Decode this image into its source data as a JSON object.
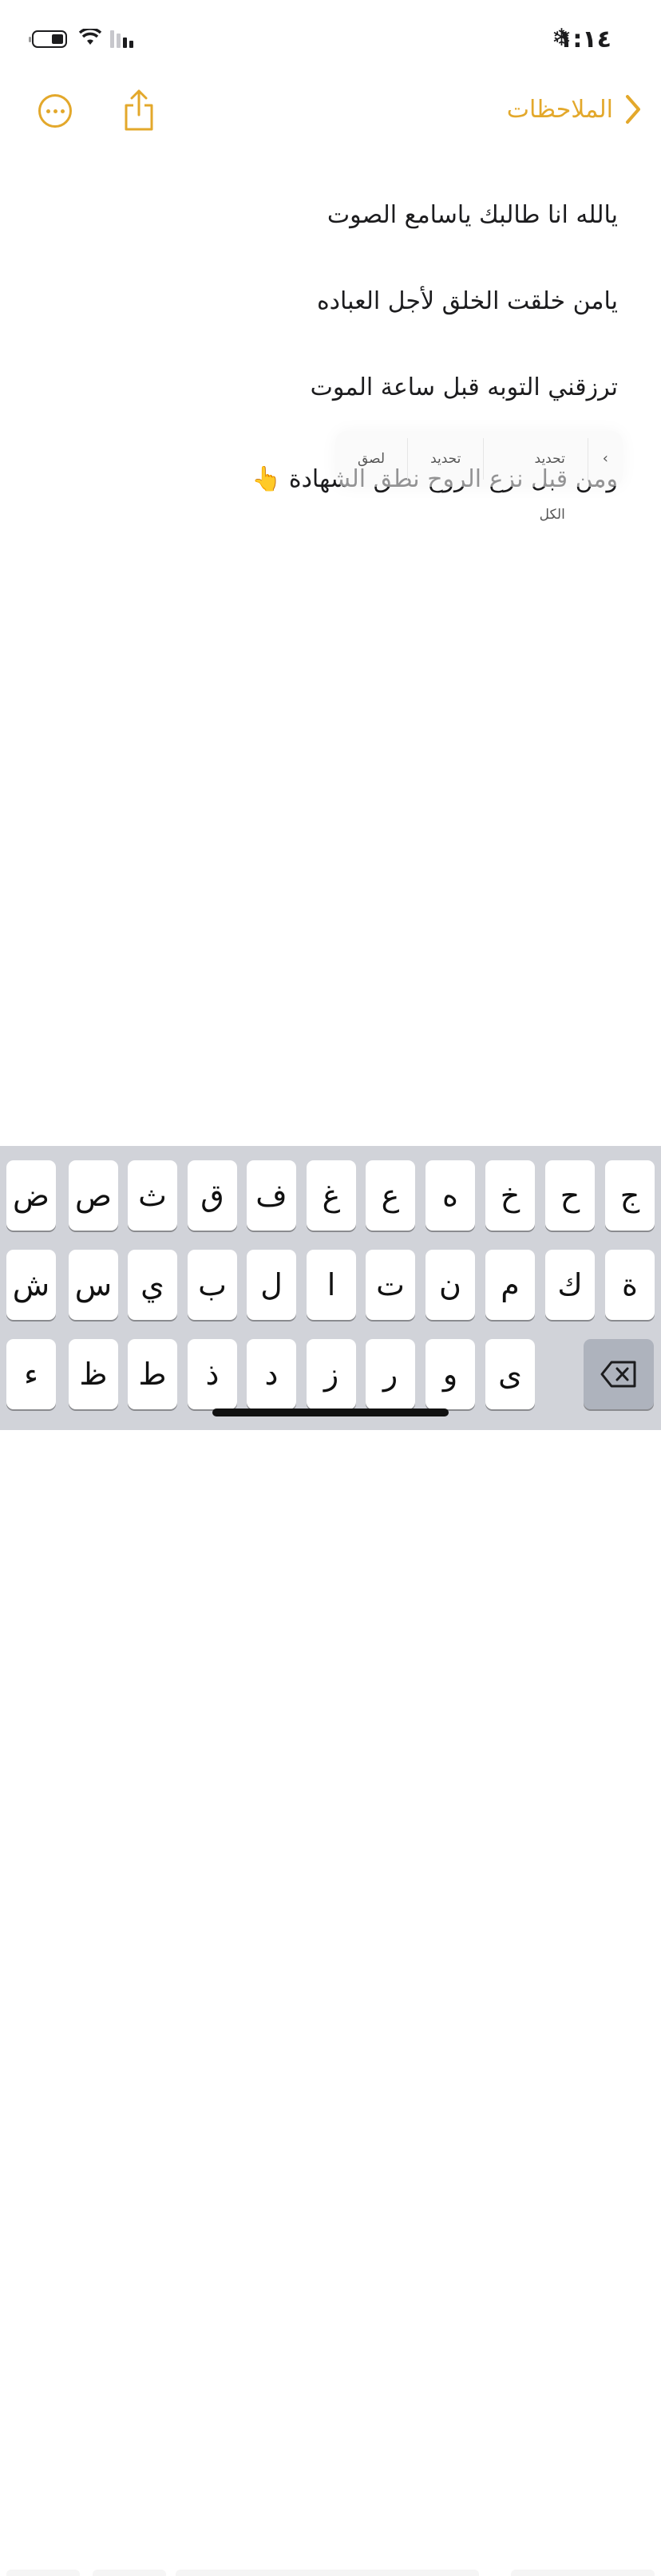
{
  "status_bar": {
    "time": "١:١٤",
    "snow_icon": "❄"
  },
  "nav": {
    "back_label": "الملاحظات",
    "accent_color": "#e3a82b"
  },
  "note": {
    "lines": [
      "يالله انا طالبك ياسامع الصوت",
      "يامن خلقت الخلق لأجل العباده",
      "ترزقني التوبه قبل ساعة الموت",
      "ومن قبل نزع الروح نطق الشهادة 👆"
    ]
  },
  "edit_menu": {
    "items": [
      "لصق",
      "تحديد",
      "تحديد الكل"
    ],
    "more_label": "›"
  },
  "keyboard": {
    "row1": [
      "ج",
      "ح",
      "خ",
      "ه",
      "ع",
      "غ",
      "ف",
      "ق",
      "ث",
      "ص",
      "ض"
    ],
    "row2": [
      "ة",
      "ك",
      "م",
      "ن",
      "ت",
      "ا",
      "ل",
      "ب",
      "ي",
      "س",
      "ش"
    ],
    "row3": [
      "ى",
      "و",
      "ر",
      "ز",
      "د",
      "ذ",
      "ط",
      "ظ",
      "ء"
    ]
  }
}
